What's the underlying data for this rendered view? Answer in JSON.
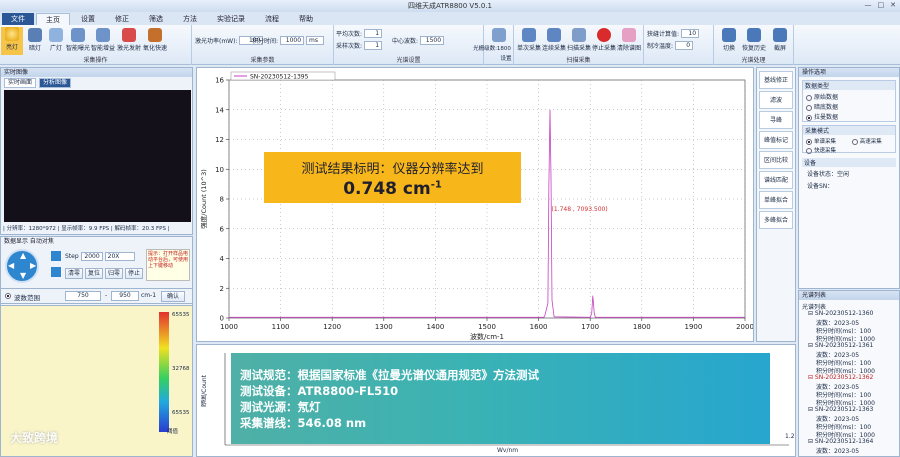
{
  "window": {
    "title": "四维天成ATR8800 V5.0.1",
    "controls": [
      "—",
      "□",
      "✕"
    ]
  },
  "tabs": [
    "文件",
    "主页",
    "设置",
    "修正",
    "筛选",
    "方法",
    "实验记录",
    "流程",
    "帮助"
  ],
  "ribbon": {
    "buttons1": [
      "亮灯",
      "暗灯",
      "广灯",
      "智能曝光",
      "智能增益",
      "激光发射",
      "氧化快速"
    ],
    "group1": "采集操作",
    "laser_label": "激光功率(mW):",
    "laser_value": "100",
    "int_label": "积分时间:",
    "int_value": "1000",
    "int_unit": "ms",
    "group2": "采集参数",
    "avg_label": "平均次数:",
    "avg_value": "1",
    "repeat_label": "采样次数:",
    "repeat_value": "1",
    "center_label": "中心波数:",
    "center_value": "1500",
    "grating_label": "光栅级数:1800",
    "setting_label": "设置",
    "group3": "光谱设置",
    "buttons4": [
      "单次采集",
      "连续采集",
      "扫描采集",
      "停止采集",
      "清除谱图"
    ],
    "group4": "扫描采集",
    "slit_label": "狭缝计算值:",
    "slit_value": "10",
    "temp_label": "制冷温度:",
    "temp_value": "0",
    "buttons5": [
      "切换",
      "恢复历史",
      "截屏"
    ],
    "group5": "光谱处理"
  },
  "camera": {
    "head": "实时图像",
    "subtabs": [
      "实时画面",
      "分析图像"
    ],
    "status": "| 分辨率：1280*972 | 显示帧率：9.9 FPS | 解码帧率：20.3 FPS |"
  },
  "stage": {
    "head": "数据显示  自动对焦",
    "step_label": "Step",
    "step_value": "2000",
    "speed": "20X",
    "buttons": [
      "清零",
      "复位",
      "归零",
      "停止"
    ],
    "note": "提示：打开样品电动平台后，可使用上下键移动"
  },
  "range": {
    "label": "波数范围",
    "min": "750",
    "max": "950",
    "unit": "cm-1",
    "btn": "确认"
  },
  "colorbar": {
    "labels": [
      "65535",
      "32768",
      "65535"
    ],
    "bottom": "阈值"
  },
  "main_plot": {
    "legend": "SN-20230512-1395",
    "xlabel": "波数/cm-1",
    "ylabel": "强度/Count (10^3)",
    "annotation": "(1.748 , 7093.500)"
  },
  "chart_data": [
    {
      "type": "line",
      "xlabel": "波数/cm-1",
      "ylabel": "强度/Count (10^3)",
      "xlim": [
        1000,
        2000
      ],
      "ylim": [
        0,
        16
      ],
      "xticks": [
        "1000",
        "1100",
        "1200",
        "1300",
        "1400",
        "1500",
        "1600",
        "1700",
        "1800",
        "1900",
        "2000"
      ],
      "yticks": [
        "0",
        "2",
        "4",
        "6",
        "8",
        "10",
        "12",
        "14",
        "16"
      ],
      "series": [
        {
          "name": "SN-20230512-1395",
          "x": [
            1000,
            1610,
            1612,
            1618,
            1620,
            1622,
            1624,
            1626,
            1630,
            1700,
            1703,
            1705,
            1708,
            1710,
            2000
          ],
          "y": [
            0.05,
            0.05,
            0.15,
            1.0,
            9.0,
            14.0,
            9.5,
            1.2,
            0.08,
            0.05,
            0.3,
            1.5,
            0.3,
            0.05,
            0.05
          ]
        }
      ],
      "grid": true,
      "legend": "top-left"
    }
  ],
  "bottom_plot": {
    "xlabel": "Wv/nm",
    "ylabel": "强度/Count",
    "xmax_label": "1.2"
  },
  "side": {
    "buttons": [
      "基线修正",
      "滤波",
      "寻峰",
      "峰值标记",
      "区间比较",
      "谱线匹配",
      "单峰拟合",
      "多峰拟合"
    ]
  },
  "right": {
    "head": "操作选项",
    "mode_head": "数据类型",
    "modes": [
      "原始数据",
      "暗底数据",
      "拉曼数据"
    ],
    "sample_head": "采集模式",
    "samples": [
      "单谱采集",
      "高速采集",
      "快速采集"
    ],
    "device_head": "设备",
    "device_status_label": "设备状态：",
    "device_status": "空闲",
    "device_sn_label": "设备SN："
  },
  "tree": {
    "head": "光谱列表",
    "items": [
      "光谱列表",
      "SN-20230512-1360",
      "波数：2023-05",
      "积分时间(ms)：100",
      "积分时间(ms)：1000",
      "SN-20230512-1361",
      "波数：2023-05",
      "积分时间(ms)：100",
      "积分时间(ms)：1000",
      "SN-20230512-1362",
      "波数：2023-05",
      "积分时间(ms)：100",
      "积分时间(ms)：1000",
      "SN-20230512-1363",
      "波数：2023-05",
      "积分时间(ms)：100",
      "积分时间(ms)：1000",
      "SN-20230512-1364",
      "波数：2023-05"
    ]
  },
  "overlay_top": {
    "line1": "测试结果标明：仪器分辨率达到",
    "line2": "0.748 cm",
    "line2_sup": "-1"
  },
  "overlay_bottom": [
    "测试规范：根据国家标准《拉曼光谱仪通用规范》方法测试",
    "测试设备：ATR8800-FL510",
    "测试光源：氖灯",
    "采集谱线：546.08 nm"
  ],
  "watermark": "大致跨境",
  "colors": {
    "accent": "#2b5797",
    "peak": "#c542c0",
    "overlay_orange": "#f7b71a"
  }
}
